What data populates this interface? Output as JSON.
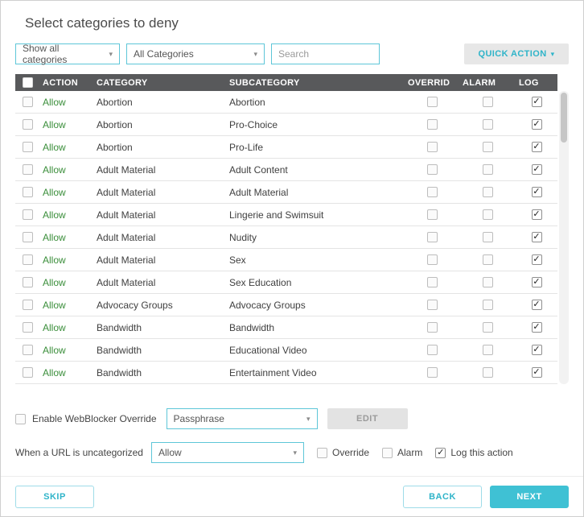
{
  "title": "Select categories to deny",
  "filters": {
    "show_filter_value": "Show all categories",
    "category_filter_value": "All Categories",
    "search_placeholder": "Search",
    "quick_action_label": "QUICK ACTION"
  },
  "table": {
    "headers": [
      "ACTION",
      "CATEGORY",
      "SUBCATEGORY",
      "OVERRID",
      "ALARM",
      "LOG"
    ],
    "rows": [
      {
        "action": "Allow",
        "category": "Abortion",
        "subcategory": "Abortion",
        "override": false,
        "alarm": false,
        "log": true
      },
      {
        "action": "Allow",
        "category": "Abortion",
        "subcategory": "Pro-Choice",
        "override": false,
        "alarm": false,
        "log": true
      },
      {
        "action": "Allow",
        "category": "Abortion",
        "subcategory": "Pro-Life",
        "override": false,
        "alarm": false,
        "log": true
      },
      {
        "action": "Allow",
        "category": "Adult Material",
        "subcategory": "Adult Content",
        "override": false,
        "alarm": false,
        "log": true
      },
      {
        "action": "Allow",
        "category": "Adult Material",
        "subcategory": "Adult Material",
        "override": false,
        "alarm": false,
        "log": true
      },
      {
        "action": "Allow",
        "category": "Adult Material",
        "subcategory": "Lingerie and Swimsuit",
        "override": false,
        "alarm": false,
        "log": true
      },
      {
        "action": "Allow",
        "category": "Adult Material",
        "subcategory": "Nudity",
        "override": false,
        "alarm": false,
        "log": true
      },
      {
        "action": "Allow",
        "category": "Adult Material",
        "subcategory": "Sex",
        "override": false,
        "alarm": false,
        "log": true
      },
      {
        "action": "Allow",
        "category": "Adult Material",
        "subcategory": "Sex Education",
        "override": false,
        "alarm": false,
        "log": true
      },
      {
        "action": "Allow",
        "category": "Advocacy Groups",
        "subcategory": "Advocacy Groups",
        "override": false,
        "alarm": false,
        "log": true
      },
      {
        "action": "Allow",
        "category": "Bandwidth",
        "subcategory": "Bandwidth",
        "override": false,
        "alarm": false,
        "log": true
      },
      {
        "action": "Allow",
        "category": "Bandwidth",
        "subcategory": "Educational Video",
        "override": false,
        "alarm": false,
        "log": true
      },
      {
        "action": "Allow",
        "category": "Bandwidth",
        "subcategory": "Entertainment Video",
        "override": false,
        "alarm": false,
        "log": true
      }
    ]
  },
  "override_section": {
    "enable_label": "Enable WebBlocker Override",
    "enabled": false,
    "method_value": "Passphrase",
    "edit_label": "EDIT"
  },
  "uncategorized_section": {
    "label": "When a URL is uncategorized",
    "action_value": "Allow",
    "override_label": "Override",
    "override_checked": false,
    "alarm_label": "Alarm",
    "alarm_checked": false,
    "log_label": "Log this action",
    "log_checked": true
  },
  "footer": {
    "skip_label": "SKIP",
    "back_label": "BACK",
    "next_label": "NEXT"
  },
  "colors": {
    "accent_teal": "#3fc1d4",
    "dropdown_border": "#5ec6d8",
    "table_header_bg": "#58595b",
    "allow_green": "#3a8e3a",
    "disabled_button_bg": "#e3e3e3"
  }
}
